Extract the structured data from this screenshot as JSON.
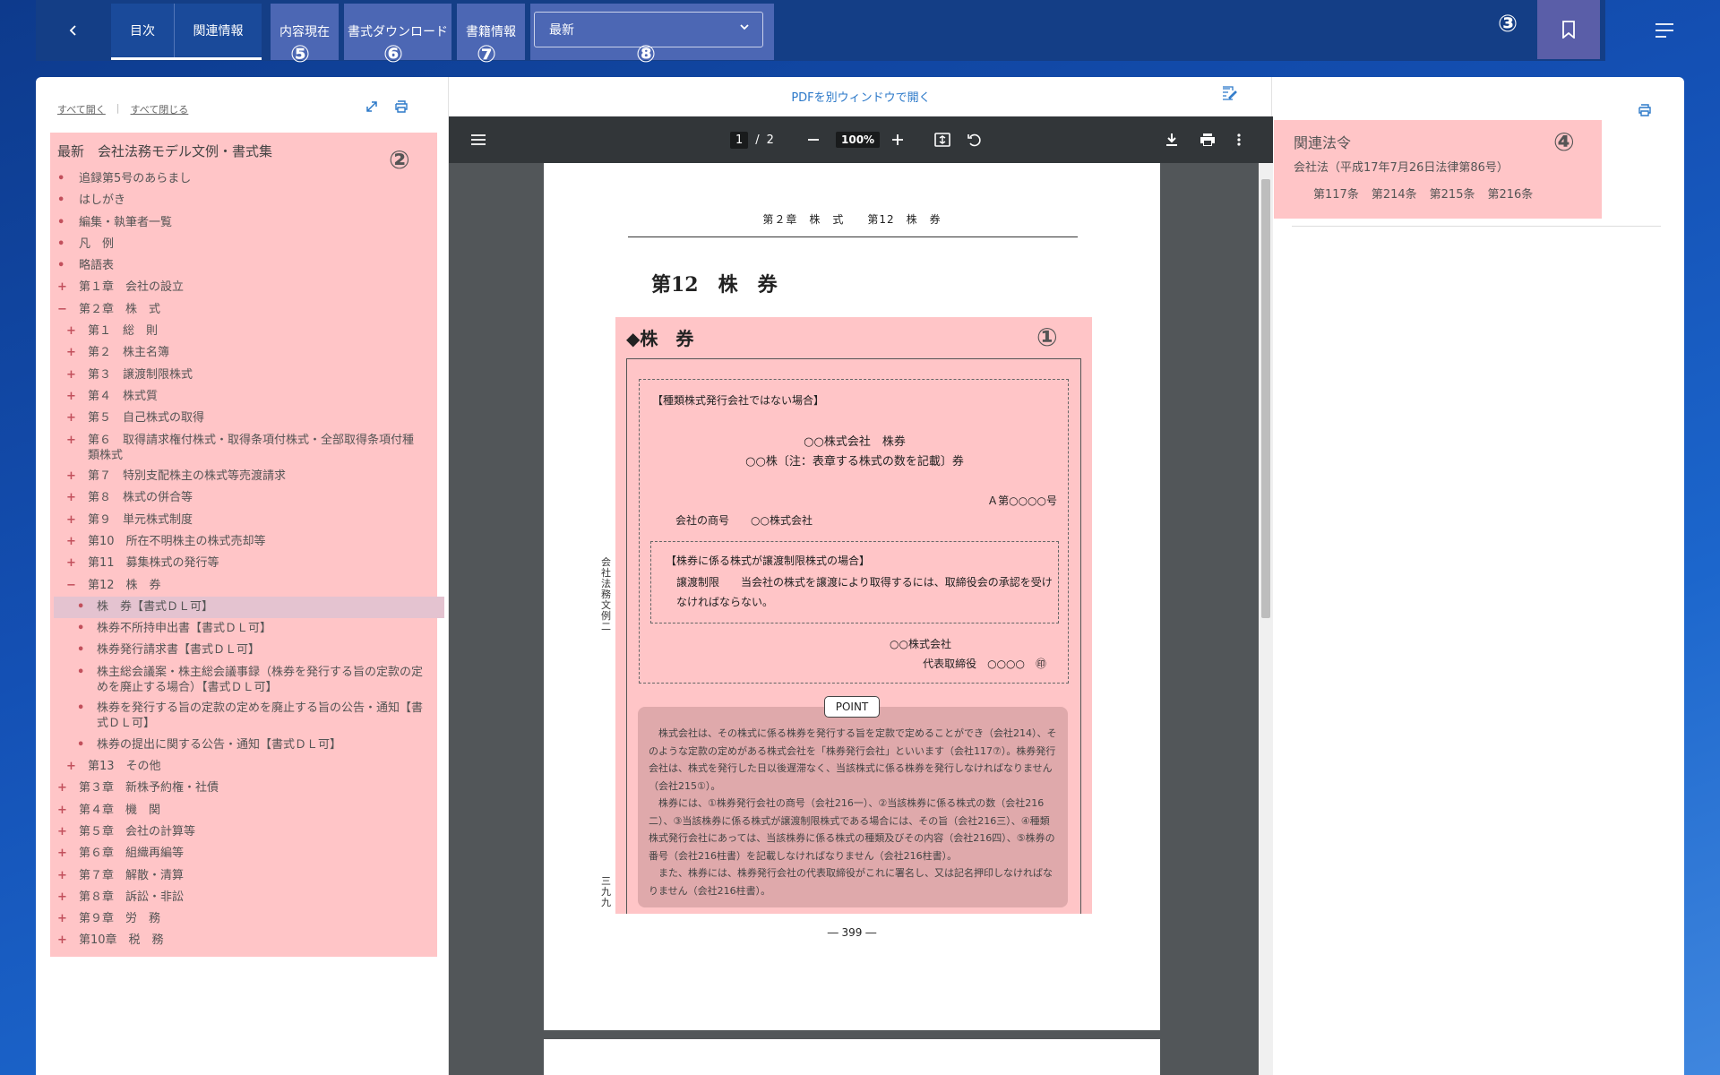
{
  "topbar": {
    "tabs": [
      {
        "label": "目次"
      },
      {
        "label": "関連情報"
      }
    ],
    "highlighted_tabs": [
      {
        "label": "内容現在",
        "marker": "⑤"
      },
      {
        "label": "書式ダウンロード",
        "marker": "⑥"
      },
      {
        "label": "書籍情報",
        "marker": "⑦"
      }
    ],
    "edition_select": {
      "value": "最新",
      "marker": "⑧"
    },
    "bookmark_marker": "③"
  },
  "toc": {
    "expand_all": "すべて開く",
    "collapse_all": "すべて閉じる",
    "title": "最新　会社法務モデル文例・書式集",
    "marker": "②",
    "items": [
      {
        "mk": "•",
        "label": "追録第5号のあらまし"
      },
      {
        "mk": "•",
        "label": "はしがき"
      },
      {
        "mk": "•",
        "label": "編集・執筆者一覧"
      },
      {
        "mk": "•",
        "label": "凡　例"
      },
      {
        "mk": "•",
        "label": "略語表"
      },
      {
        "mk": "+",
        "label": "第１章　会社の設立"
      },
      {
        "mk": "−",
        "label": "第２章　株　式"
      },
      {
        "mk": "+",
        "label": "第１　総　則"
      },
      {
        "mk": "+",
        "label": "第２　株主名簿"
      },
      {
        "mk": "+",
        "label": "第３　譲渡制限株式"
      },
      {
        "mk": "+",
        "label": "第４　株式質"
      },
      {
        "mk": "+",
        "label": "第５　自己株式の取得"
      },
      {
        "mk": "+",
        "label": "第６　取得請求権付株式・取得条項付株式・全部取得条項付種類株式"
      },
      {
        "mk": "+",
        "label": "第７　特別支配株主の株式等売渡請求"
      },
      {
        "mk": "+",
        "label": "第８　株式の併合等"
      },
      {
        "mk": "+",
        "label": "第９　単元株式制度"
      },
      {
        "mk": "+",
        "label": "第10　所在不明株主の株式売却等"
      },
      {
        "mk": "+",
        "label": "第11　募集株式の発行等"
      },
      {
        "mk": "−",
        "label": "第12　株　券"
      },
      {
        "mk": "•",
        "label": "株　券【書式ＤＬ可】"
      },
      {
        "mk": "•",
        "label": "株券不所持申出書【書式ＤＬ可】"
      },
      {
        "mk": "•",
        "label": "株券発行請求書【書式ＤＬ可】"
      },
      {
        "mk": "•",
        "label": "株主総会議案・株主総会議事録（株券を発行する旨の定款の定めを廃止する場合）【書式ＤＬ可】"
      },
      {
        "mk": "•",
        "label": "株券を発行する旨の定款の定めを廃止する旨の公告・通知【書式ＤＬ可】"
      },
      {
        "mk": "•",
        "label": "株券の提出に関する公告・通知【書式ＤＬ可】"
      },
      {
        "mk": "+",
        "label": "第13　その他"
      },
      {
        "mk": "+",
        "label": "第３章　新株予約権・社債"
      },
      {
        "mk": "+",
        "label": "第４章　機　関"
      },
      {
        "mk": "+",
        "label": "第５章　会社の計算等"
      },
      {
        "mk": "+",
        "label": "第６章　組織再編等"
      },
      {
        "mk": "+",
        "label": "第７章　解散・清算"
      },
      {
        "mk": "+",
        "label": "第８章　訴訟・非訟"
      },
      {
        "mk": "+",
        "label": "第９章　労　務"
      },
      {
        "mk": "+",
        "label": "第10章　税　務"
      }
    ]
  },
  "viewer": {
    "open_pdf_link": "PDFを別ウィンドウで開く",
    "current_page": "1",
    "page_sep": "/",
    "total_pages": "2",
    "zoom": "100%"
  },
  "document": {
    "running_head": "第２章　株　式　　第12　株　券",
    "section_title": "第12　株　券",
    "heading": "◆株　券",
    "marker": "①",
    "case_label": "【種類株式発行会社ではない場合】",
    "cert_line1": "○○株式会社　株券",
    "cert_line2": "○○株〔注：表章する株式の数を記載〕券",
    "cert_number": "Ａ第○○○○号",
    "company_name_line": "会社の商号　　○○株式会社",
    "restriction_label": "【株券に係る株式が譲渡制限株式の場合】",
    "restriction_text": "譲渡制限　　当会社の株式を譲渡により取得するには、取締役会の承認を受けなければならない。",
    "signer_company": "○○株式会社",
    "signer_rep": "代表取締役　○○○○　㊞",
    "point_label": "POINT",
    "point_text": [
      "　株式会社は、その株式に係る株券を発行する旨を定款で定めることができ（会社214）、そのような定款の定めがある株式会社を「株券発行会社」といいます（会社117⑦）。株券発行会社は、株式を発行した日以後遅滞なく、当該株式に係る株券を発行しなければなりません（会社215①）。",
      "　株券には、①株券発行会社の商号（会社216一）、②当該株券に係る株式の数（会社216二）、③当該株券に係る株式が譲渡制限株式である場合には、その旨（会社216三）、④種類株式発行会社にあっては、当該株券に係る株式の種類及びその内容（会社216四）、⑤株券の番号（会社216柱書）を記載しなければなりません（会社216柱書）。",
      "　また、株券には、株券発行会社の代表取締役がこれに署名し、又は記名押印しなければなりません（会社216柱書）。"
    ],
    "side_text": "会社法務文例二",
    "side_num": "三九九",
    "page_number": "― 399 ―"
  },
  "related": {
    "title": "関連法令",
    "marker": "④",
    "law": "会社法（平成17年7月26日法律第86号）",
    "articles": [
      "第117条",
      "第214条",
      "第215条",
      "第216条"
    ]
  },
  "colors": {
    "topbar_bg": "#143e86",
    "highlight_tab": "#4c67b4",
    "annotation_pink": "#ffc5c7",
    "link_blue": "#2c79c9",
    "pdf_toolbar": "#323639"
  }
}
